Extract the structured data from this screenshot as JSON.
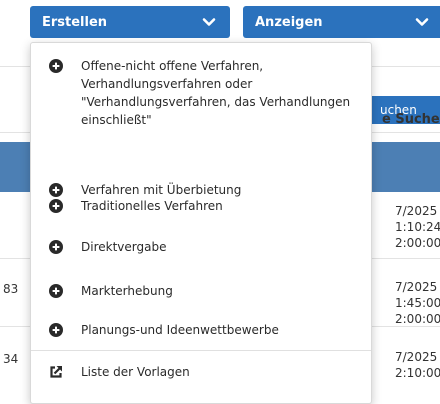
{
  "toolbar": {
    "create_label": "Erstellen",
    "view_label": "Anzeigen"
  },
  "background": {
    "search_button": "uchen",
    "search_heading": "e Suche",
    "rows": [
      {
        "id": "",
        "date": "7/2025",
        "t1": "1:10:24",
        "t2": "2:00:00"
      },
      {
        "id": "83",
        "date": "7/2025",
        "t1": "1:45:00",
        "t2": "2:00:00"
      },
      {
        "id": "34",
        "date": "7/2025",
        "t1": "2:10:00",
        "t2": ""
      }
    ]
  },
  "menu": {
    "items": [
      {
        "label": "Offene-nicht offene Verfahren, Verhandlungsverfahren oder \"Verhandlungsverfahren, das Verhandlungen einschließt\"",
        "icon": "plus-circle-icon"
      },
      {
        "label": "Verfahren mit Überbietung",
        "icon": "plus-circle-icon"
      },
      {
        "label": "Traditionelles Verfahren",
        "icon": "plus-circle-icon"
      },
      {
        "label": "Direktvergabe",
        "icon": "plus-circle-icon"
      },
      {
        "label": "Markterhebung",
        "icon": "plus-circle-icon"
      },
      {
        "label": "Planungs-und Ideenwettbewerbe",
        "icon": "plus-circle-icon"
      },
      {
        "label": "Liste der Vorlagen",
        "icon": "external-link-icon"
      }
    ]
  },
  "colors": {
    "primary": "#2b72bd",
    "table_header": "#4c7fb4"
  }
}
